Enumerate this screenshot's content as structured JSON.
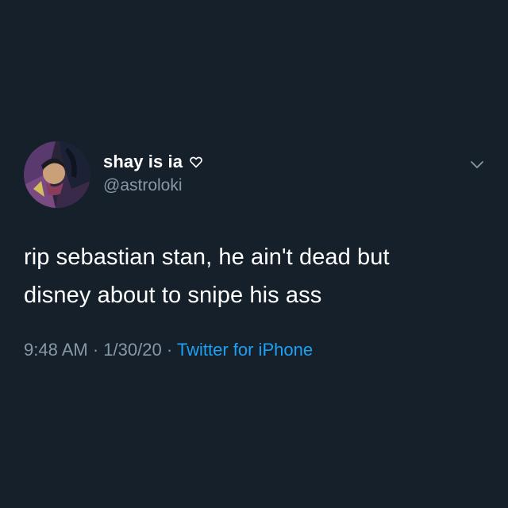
{
  "tweet": {
    "author": {
      "display_name": "shay is ia",
      "handle": "@astroloki",
      "badge_icon": "heart-outline-icon"
    },
    "text_lines": [
      "rip sebastian stan, he ain't dead but",
      "disney about to snipe his ass"
    ],
    "time": "9:48 AM",
    "date": "1/30/20",
    "source": "Twitter for iPhone",
    "separator": "·",
    "menu_icon": "chevron-down-icon"
  },
  "colors": {
    "background": "#15202b",
    "primary_text": "#ffffff",
    "secondary_text": "#8899a6",
    "link": "#1da1f2"
  }
}
